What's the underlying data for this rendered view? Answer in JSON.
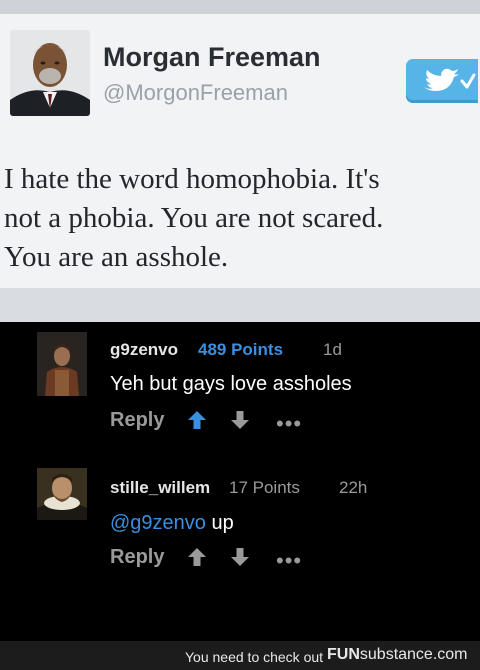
{
  "tweet": {
    "name": "Morgan Freeman",
    "handle": "@MorgonFreeman",
    "lines": [
      "I hate the word homophobia. It's",
      "not a phobia. You are not scared.",
      "You are an asshole."
    ],
    "bird_color": "#56b4e6"
  },
  "comments": [
    {
      "username": "g9zenvo",
      "points": "489 Points",
      "points_color": "#3a8fe0",
      "time": "1d",
      "text_parts": [
        "Yeh but gays love assholes"
      ],
      "reply": "Reply",
      "upvoted": true
    },
    {
      "username": "stille_willem",
      "points": "17 Points",
      "points_color": "#9a9a9a",
      "time": "22h",
      "mention": "@g9zenvo",
      "text_after": " up",
      "reply": "Reply",
      "upvoted": false
    }
  ],
  "footer": {
    "text": "You need to check out",
    "brand_bold": "FUN",
    "brand_rest": "substance.com"
  },
  "icons": {
    "upvote": "up-arrow-icon",
    "downvote": "down-arrow-icon",
    "more": "more-dots-icon",
    "twitter": "twitter-bird-icon"
  },
  "colors": {
    "mention": "#3a8fe0",
    "upvote_active": "#3a8fe0"
  }
}
